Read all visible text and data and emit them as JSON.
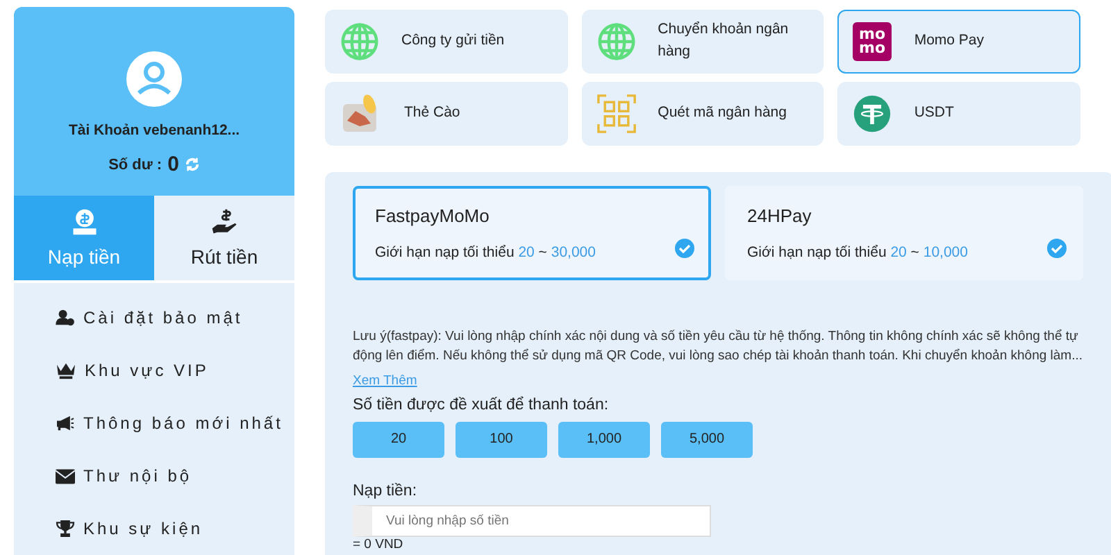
{
  "profile": {
    "account": "Tài Khoản vebenanh12...",
    "balance_label": "Số dư :",
    "balance": "0"
  },
  "tabs": [
    {
      "label": "Nạp tiền",
      "kind": "deposit",
      "selected": true
    },
    {
      "label": "Rút tiền",
      "kind": "withdraw",
      "selected": false
    }
  ],
  "menu": [
    {
      "label": "Cài đặt bảo mật",
      "kind": "security"
    },
    {
      "label": "Khu vực VIP",
      "kind": "vip"
    },
    {
      "label": "Thông báo mới nhất",
      "kind": "notice"
    },
    {
      "label": "Thư nội bộ",
      "kind": "mail"
    },
    {
      "label": "Khu sự kiện",
      "kind": "trophy"
    }
  ],
  "methods": [
    {
      "label": "Công ty gửi tiền",
      "kind": "globe",
      "selected": false
    },
    {
      "label": "Chuyển khoản ngân hàng",
      "kind": "globe",
      "selected": false
    },
    {
      "label": "Momo Pay",
      "kind": "momo",
      "logo_lines": [
        "mo",
        "mo"
      ],
      "selected": true
    },
    {
      "label": "Thẻ Cào",
      "kind": "card",
      "selected": false
    },
    {
      "label": "Quét mã ngân hàng",
      "kind": "qr",
      "selected": false
    },
    {
      "label": "USDT",
      "kind": "tether",
      "selected": false
    }
  ],
  "channels": [
    {
      "name": "FastpayMoMo",
      "limit_label": "Giới hạn nạp tối thiểu",
      "min": "20",
      "sep": "~",
      "max": "30,000",
      "selected": true
    },
    {
      "name": "24HPay",
      "limit_label": "Giới hạn nạp tối thiểu",
      "min": "20",
      "sep": "~",
      "max": "10,000",
      "selected": false
    }
  ],
  "note": "Lưu ý(fastpay): Vui lòng nhập chính xác nội dung và số tiền yêu cầu từ hệ thống. Thông tin không chính xác sẽ không thể tự động lên điểm. Nếu không thể sử dụng mã QR Code, vui lòng sao chép tài khoản thanh toán. Khi chuyển khoản không làm...",
  "more_link": "Xem Thêm",
  "suggest_label": "Số tiền được đề xuất để thanh toán:",
  "amounts": [
    "20",
    "100",
    "1,000",
    "5,000"
  ],
  "deposit_label": "Nạp tiền:",
  "amount_field": {
    "placeholder": "Vui lòng nhập số tiền"
  },
  "converted": "= 0 VND"
}
